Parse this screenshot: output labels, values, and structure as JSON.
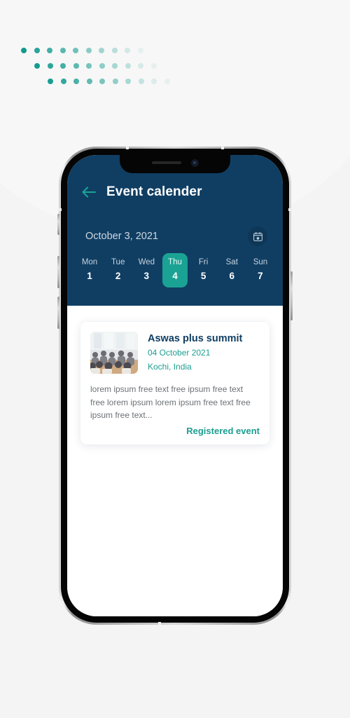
{
  "decor": {
    "dot_grid": {
      "rows": 3,
      "columns": 10,
      "base_color": "#109a8d",
      "note": "teal dots fading to transparent toward the right, each row offset right"
    },
    "backdrop_circle_color": "#f7f7f7",
    "page_background_color": "#f4f4f4"
  },
  "device": {
    "frame_color": "#050505",
    "rail_color": "#d8d8d8",
    "notch": {
      "speaker_icon": "speaker-grille-icon",
      "camera_icon": "front-camera-icon"
    },
    "buttons": [
      {
        "name": "silent-switch",
        "side": "left"
      },
      {
        "name": "volume-up-button",
        "side": "left"
      },
      {
        "name": "volume-down-button",
        "side": "left"
      },
      {
        "name": "power-button",
        "side": "right"
      }
    ]
  },
  "header": {
    "background_color": "#103e63",
    "back_icon": "arrow-left-icon",
    "back_icon_color": "#1aa394",
    "title": "Event calender",
    "current_date": "October 3, 2021",
    "calendar_button_icon": "calendar-star-icon"
  },
  "week_strip": {
    "accent_color": "#1aa394",
    "days": [
      {
        "name": "Mon",
        "number": "1",
        "active": false
      },
      {
        "name": "Tue",
        "number": "2",
        "active": false
      },
      {
        "name": "Wed",
        "number": "3",
        "active": false
      },
      {
        "name": "Thu",
        "number": "4",
        "active": true
      },
      {
        "name": "Fri",
        "number": "5",
        "active": false
      },
      {
        "name": "Sat",
        "number": "6",
        "active": false
      },
      {
        "name": "Sun",
        "number": "7",
        "active": false
      }
    ]
  },
  "events": [
    {
      "thumbnail_icon": "conference-audience-photo",
      "title": "Aswas plus summit",
      "date": "04 October 2021",
      "location": "Kochi, India",
      "description": "lorem ipsum free text free ipsum free text free lorem ipsum  lorem ipsum free text free ipsum free text...",
      "status_label": "Registered event",
      "status_color": "#1d9e91"
    }
  ]
}
